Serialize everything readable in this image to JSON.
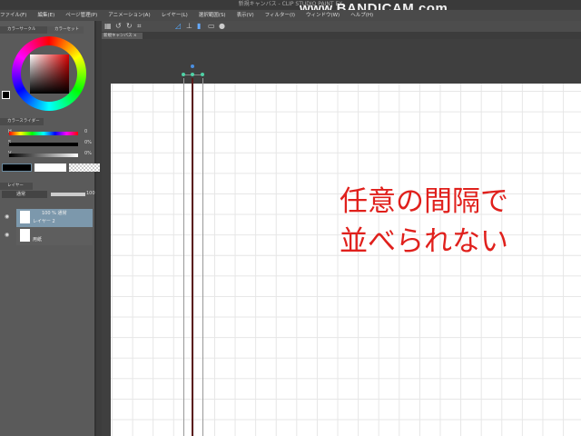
{
  "window": {
    "title": "新規キャンバス - CLIP STUDIO PAINT EX"
  },
  "watermark": "www.BANDICAM.com",
  "menu": [
    "ファイル(F)",
    "編集(E)",
    "ページ管理(P)",
    "アニメーション(A)",
    "レイヤー(L)",
    "選択範囲(S)",
    "表示(V)",
    "フィルター(I)",
    "ウィンドウ(W)",
    "ヘルプ(H)"
  ],
  "document_tab": "新規キャンバス ×",
  "panels": {
    "color_wheel_tab": "カラーサークル",
    "color_set_tab": "カラーセット",
    "color_slider_tab": "カラースライダー",
    "sliders": [
      {
        "label": "H",
        "value": "0"
      },
      {
        "label": "S",
        "value": "0%"
      },
      {
        "label": "V",
        "value": "0%"
      }
    ],
    "layer_tab": "レイヤー",
    "blend_mode": "通常",
    "opacity": "100",
    "layers": [
      {
        "info": "100 % 通常",
        "name": "レイヤー 2",
        "selected": true
      },
      {
        "info": "",
        "name": "用紙",
        "selected": false
      }
    ]
  },
  "annotation": [
    "任意の間隔で",
    "並べられない"
  ],
  "colors": {
    "annotation": "#e0201c",
    "ruler_line": "#5a1a1a"
  }
}
